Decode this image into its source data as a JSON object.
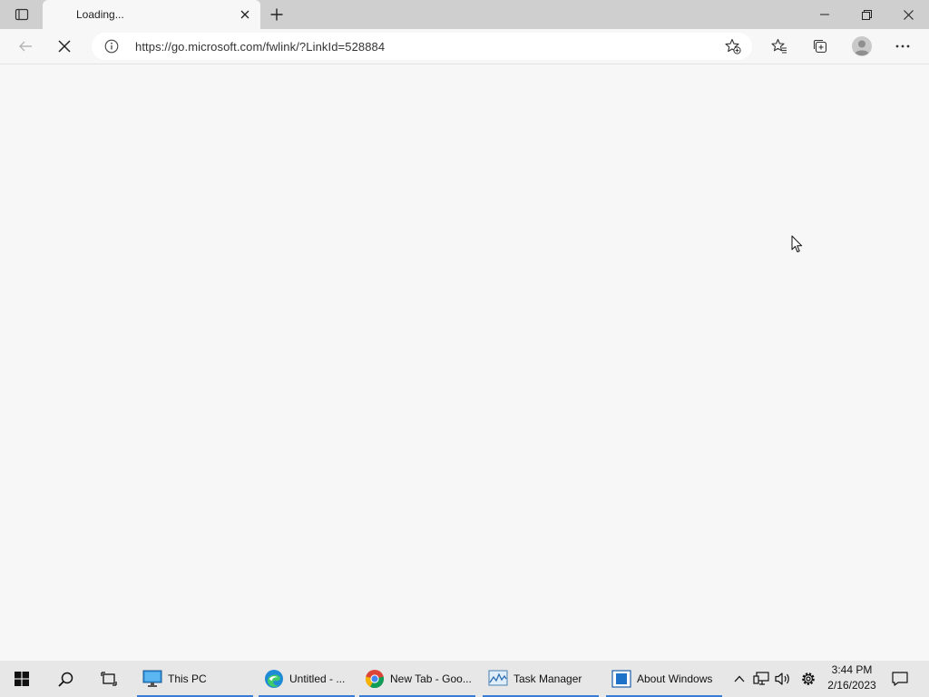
{
  "browser": {
    "tab": {
      "title": "Loading..."
    },
    "address_bar": {
      "url": "https://go.microsoft.com/fwlink/?LinkId=528884"
    },
    "icons": {
      "tab_actions": "tab-actions-icon",
      "close_tab": "close-icon",
      "new_tab": "plus-icon",
      "back": "back-arrow-icon",
      "stop": "stop-loading-icon",
      "info": "info-icon",
      "add_favorite": "star-add-icon",
      "favorites": "favorites-icon",
      "collections": "collections-icon",
      "profile": "profile-avatar-icon",
      "more": "more-options-icon"
    }
  },
  "taskbar": {
    "apps": [
      {
        "label": "This PC",
        "icon": "monitor-icon"
      },
      {
        "label": "Untitled - ...",
        "icon": "edge-icon"
      },
      {
        "label": "New Tab - Goo...",
        "icon": "chrome-icon"
      },
      {
        "label": "Task Manager",
        "icon": "task-manager-icon"
      },
      {
        "label": "About Windows",
        "icon": "winver-icon"
      }
    ],
    "clock": {
      "time": "3:44 PM",
      "date": "2/16/2023"
    }
  },
  "colors": {
    "accent": "#3a7bd5",
    "tabstrip": "#cfcfcf",
    "page_bg": "#f7f7f7",
    "taskbar": "#e7e7e7"
  }
}
